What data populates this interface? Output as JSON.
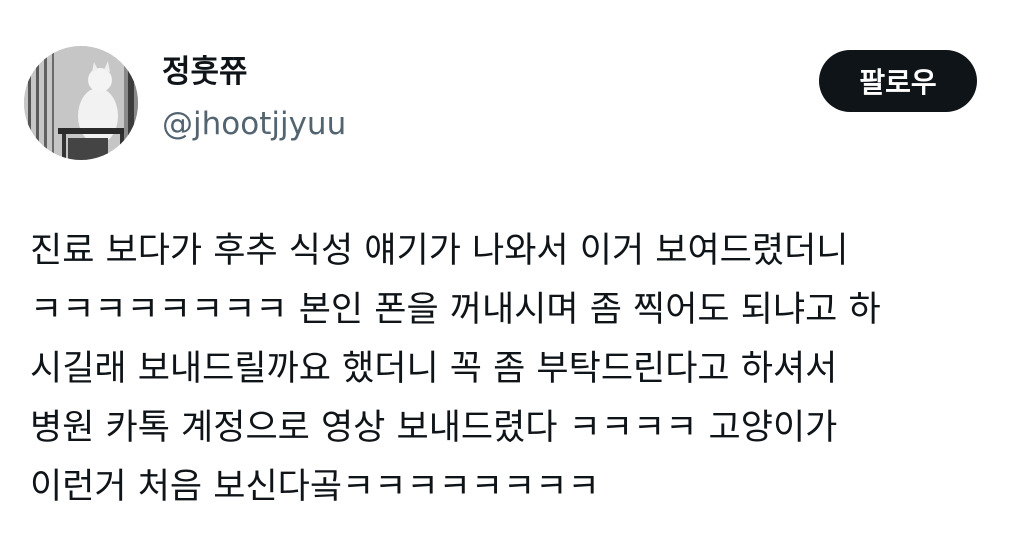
{
  "author": {
    "display_name": "정훗쮸",
    "handle": "@jhootjjyuu"
  },
  "actions": {
    "follow_label": "팔로우"
  },
  "tweet": {
    "lines": [
      "진료 보다가 후추 식성 얘기가 나와서 이거 보여드렸더니",
      "ㅋㅋㅋㅋㅋㅋㅋㅋ 본인 폰을 꺼내시며 좀 찍어도 되냐고 하",
      "시길래 보내드릴까요 했더니 꼭 좀 부탁드린다고 하셔서",
      "병원 카톡 계정으로 영상 보내드렸다 ㅋㅋㅋㅋ 고양이가",
      "이런거 처음 보신다곸ㅋㅋㅋㅋㅋㅋㅋㅋ"
    ]
  },
  "colors": {
    "text_primary": "#0f1419",
    "text_secondary": "#536471",
    "button_bg": "#0f1419",
    "button_text": "#ffffff",
    "background": "#ffffff"
  },
  "icons": {
    "avatar": "profile-photo-cat-in-cage"
  }
}
